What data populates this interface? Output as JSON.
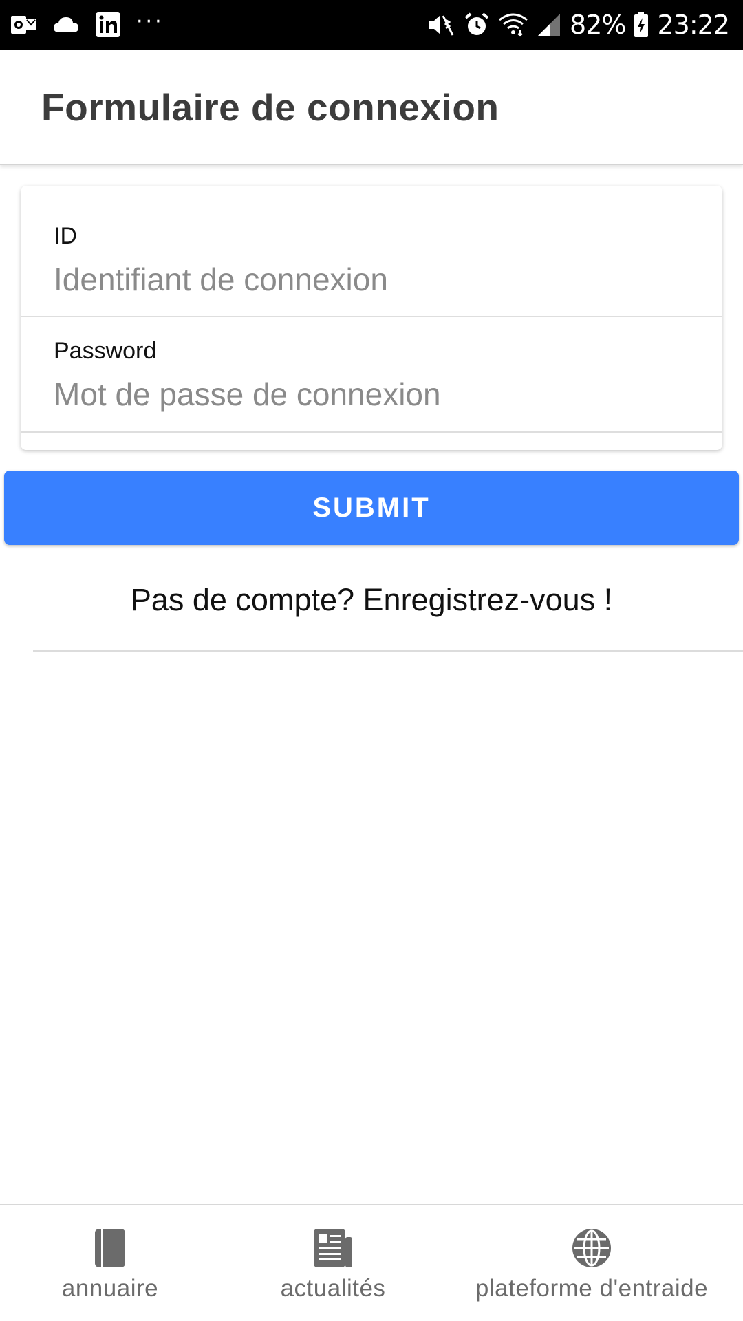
{
  "status_bar": {
    "left_icons": [
      "outlook-icon",
      "cloud-icon",
      "linkedin-icon"
    ],
    "more_label": "···",
    "right_icons": [
      "vibrate-mute-icon",
      "alarm-icon",
      "wifi-icon",
      "signal-icon"
    ],
    "battery_percent": "82%",
    "battery_icon": "battery-charging-icon",
    "time": "23:22"
  },
  "header": {
    "title": "Formulaire de connexion"
  },
  "form": {
    "id_label": "ID",
    "id_placeholder": "Identifiant de connexion",
    "password_label": "Password",
    "password_placeholder": "Mot de passe de connexion"
  },
  "submit_label": "SUBMIT",
  "register_text": "Pas de compte? Enregistrez-vous !",
  "tabs": [
    {
      "label": "annuaire",
      "icon": "book-icon"
    },
    {
      "label": "actualités",
      "icon": "newspaper-icon"
    },
    {
      "label": "plateforme d'entraide",
      "icon": "globe-icon"
    }
  ],
  "colors": {
    "primary": "#3880ff",
    "status_bar": "#000000",
    "tab_icon": "#6b6b6b",
    "title": "#3c3c3c"
  }
}
